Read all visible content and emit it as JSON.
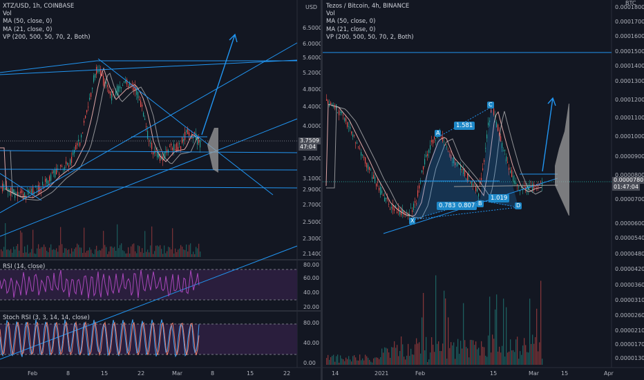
{
  "left_chart": {
    "header": [
      "XTZ/USD, 1h, COINBASE",
      "Vol",
      "MA (50, close, 0)",
      "MA (21, close, 0)",
      "VP (200, 500, 50, 70, 2, Both)"
    ],
    "currency": "USD",
    "price_ticks": [
      "6.5000",
      "6.0000",
      "5.6000",
      "5.2000",
      "4.8000",
      "4.4000",
      "4.0000",
      "3.4000",
      "3.1000",
      "2.9000",
      "2.7000",
      "2.5000",
      "2.3000",
      "2.1400"
    ],
    "last_price": "3.7509",
    "countdown": "47:04",
    "time_ticks": [
      "Feb",
      "8",
      "15",
      "22",
      "Mar",
      "8",
      "15",
      "22"
    ],
    "rsi": {
      "title": "RSI (14, close)",
      "ticks": [
        "80.00",
        "60.00",
        "40.00",
        "20.00"
      ]
    },
    "stoch": {
      "title": "Stoch RSI (3, 3, 14, 14, close)",
      "ticks": [
        "80.00",
        "40.00",
        "0.00"
      ]
    }
  },
  "right_chart": {
    "header": [
      "Tezos / Bitcoin, 4h, BINANCE",
      "Vol",
      "MA (50, close, 0)",
      "MA (21, close, 0)",
      "VP (200, 500, 50, 70, 2, Both)"
    ],
    "currency": "BTC",
    "price_ticks": [
      "0.0001800",
      "0.0001700",
      "0.0001600",
      "0.0001500",
      "0.0001400",
      "0.0001300",
      "0.0001200",
      "0.0001100",
      "0.0001000",
      "0.0000900",
      "0.0000800",
      "0.0000700",
      "0.0000600",
      "0.0000540",
      "0.0000480",
      "0.0000420",
      "0.0000360",
      "0.0000310",
      "0.0000260",
      "0.0000210",
      "0.0000170",
      "0.0000130"
    ],
    "last_price": "0.0000780",
    "countdown": "01:47:04",
    "time_ticks": [
      "14",
      "2021",
      "Feb",
      "15",
      "Mar",
      "15",
      "Apr"
    ],
    "points": [
      "X",
      "A",
      "B",
      "C",
      "D"
    ],
    "ratios": [
      "1.581",
      "0.783",
      "0.807",
      "1.019"
    ]
  },
  "colors": {
    "bg": "#131722",
    "up": "#26a69a",
    "down": "#ef5350",
    "line": "#2196f3",
    "rsi": "#ab47bc"
  }
}
